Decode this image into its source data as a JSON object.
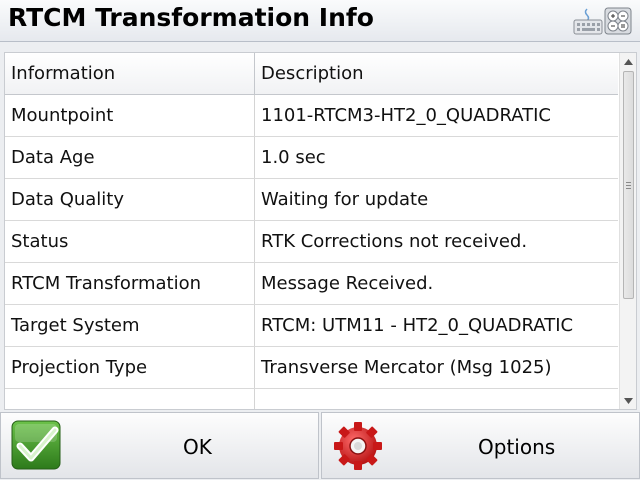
{
  "window": {
    "title": "RTCM Transformation Info",
    "keyboard_icon": "keyboard-icon",
    "calculator_icon": "calculator-icon"
  },
  "table": {
    "headers": [
      "Information",
      "Description"
    ],
    "rows": [
      [
        "Mountpoint",
        "1101-RTCM3-HT2_0_QUADRATIC"
      ],
      [
        "Data Age",
        "1.0 sec"
      ],
      [
        "Data Quality",
        "Waiting for update"
      ],
      [
        "Status",
        "RTK Corrections not received."
      ],
      [
        "RTCM Transformation",
        "Message Received."
      ],
      [
        "Target System",
        "RTCM: UTM11 - HT2_0_QUADRATIC"
      ],
      [
        "Projection Type",
        "Transverse Mercator (Msg 1025)"
      ],
      [
        "",
        ""
      ]
    ]
  },
  "buttons": {
    "ok_label": "OK",
    "ok_icon": "checkmark-icon",
    "options_label": "Options",
    "options_icon": "gear-icon"
  },
  "colors": {
    "ok_green": "#3f9a2a",
    "options_red": "#d42020"
  }
}
